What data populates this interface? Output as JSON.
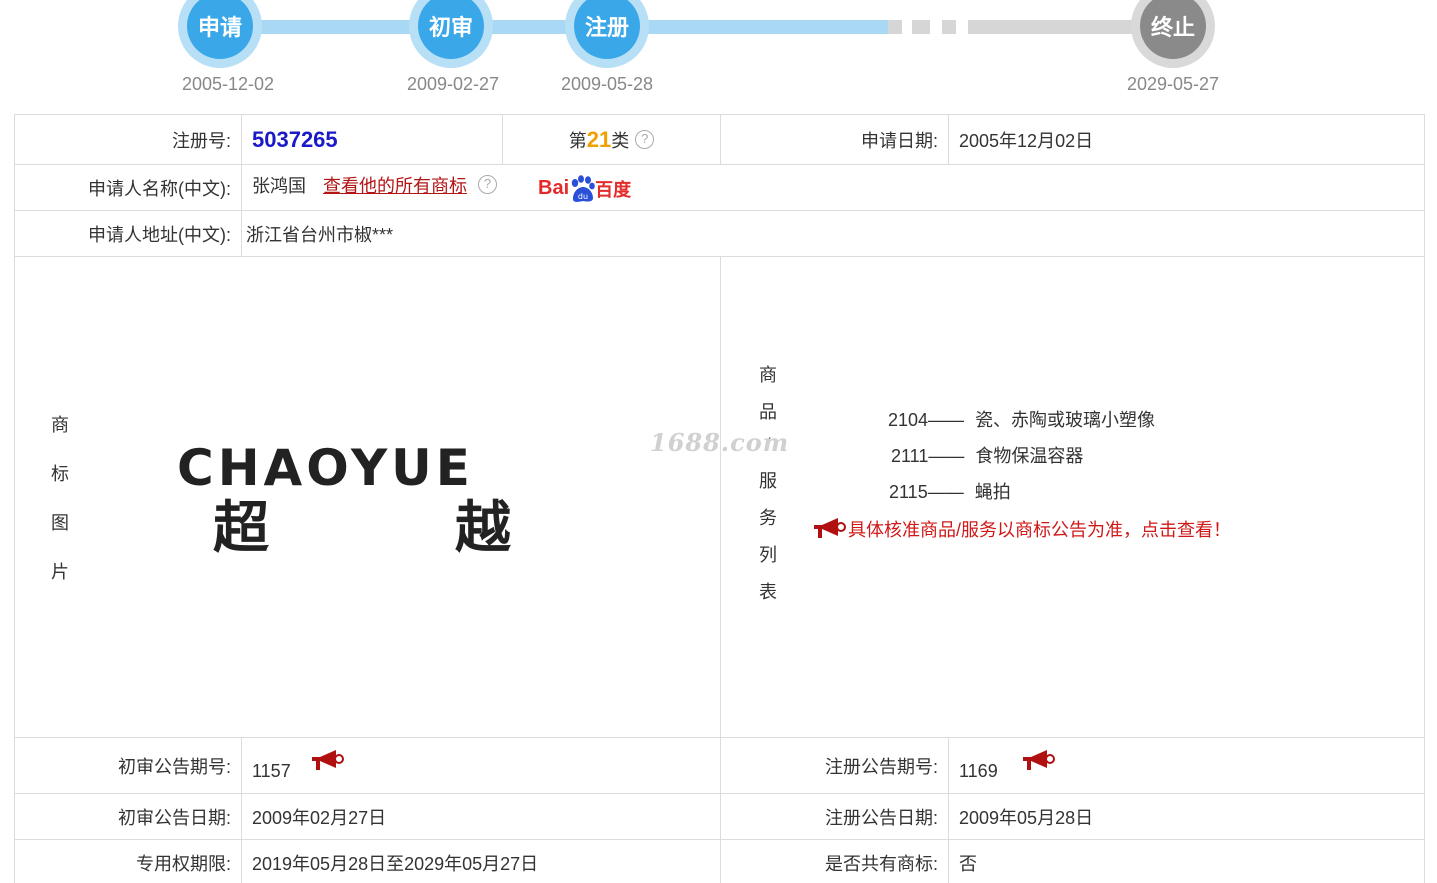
{
  "timeline": {
    "steps": [
      {
        "label": "申请",
        "date": "2005-12-02"
      },
      {
        "label": "初审",
        "date": "2009-02-27"
      },
      {
        "label": "注册",
        "date": "2009-05-28"
      },
      {
        "label": "终止",
        "date": "2029-05-27"
      }
    ]
  },
  "fields": {
    "reg_no_label": "注册号:",
    "reg_no": "5037265",
    "class_prefix": "第",
    "class_num": "21",
    "class_suffix": "类",
    "apply_date_label": "申请日期:",
    "apply_date": "2005年12月02日",
    "applicant_name_label": "申请人名称(中文):",
    "applicant_name": "张鸿国",
    "view_all_link": "查看他的所有商标",
    "baidu_left": "Bai",
    "baidu_mid": "du",
    "baidu_right": "百度",
    "applicant_addr_label": "申请人地址(中文):",
    "applicant_addr": "浙江省台州市椒***",
    "help_glyph": "?"
  },
  "trademark": {
    "image_label_chars": [
      "商",
      "标",
      "图",
      "片"
    ],
    "logo_text_en": "CHAOYUE",
    "logo_text_cn_1": "超",
    "logo_text_cn_2": "越",
    "watermark": "1688.com"
  },
  "goods": {
    "label_chars": [
      "商",
      "品",
      "/",
      "服",
      "务",
      "列",
      "表"
    ],
    "items": [
      {
        "code": "2104",
        "name": "瓷、赤陶或玻璃小塑像"
      },
      {
        "code": "2111",
        "name": "食物保温容器"
      },
      {
        "code": "2115",
        "name": "蝇拍"
      }
    ],
    "separator": "——",
    "notice": "具体核准商品/服务以商标公告为准，点击查看！"
  },
  "announce": {
    "prelim_no_label": "初审公告期号:",
    "prelim_no": "1157",
    "reg_no_label": "注册公告期号:",
    "reg_no": "1169",
    "prelim_date_label": "初审公告日期:",
    "prelim_date": "2009年02月27日",
    "reg_date_label": "注册公告日期:",
    "reg_date": "2009年05月28日",
    "exclusive_label": "专用权期限:",
    "exclusive": "2019年05月28日至2029年05月27日",
    "shared_label": "是否共有商标:",
    "shared": "否"
  },
  "colors": {
    "timeline_active": "#3aa8e8",
    "timeline_inactive": "#8a8a8a",
    "reg_no": "#1a1ac8",
    "class_num": "#f0a000",
    "link": "#b31515",
    "notice": "#d01818"
  }
}
